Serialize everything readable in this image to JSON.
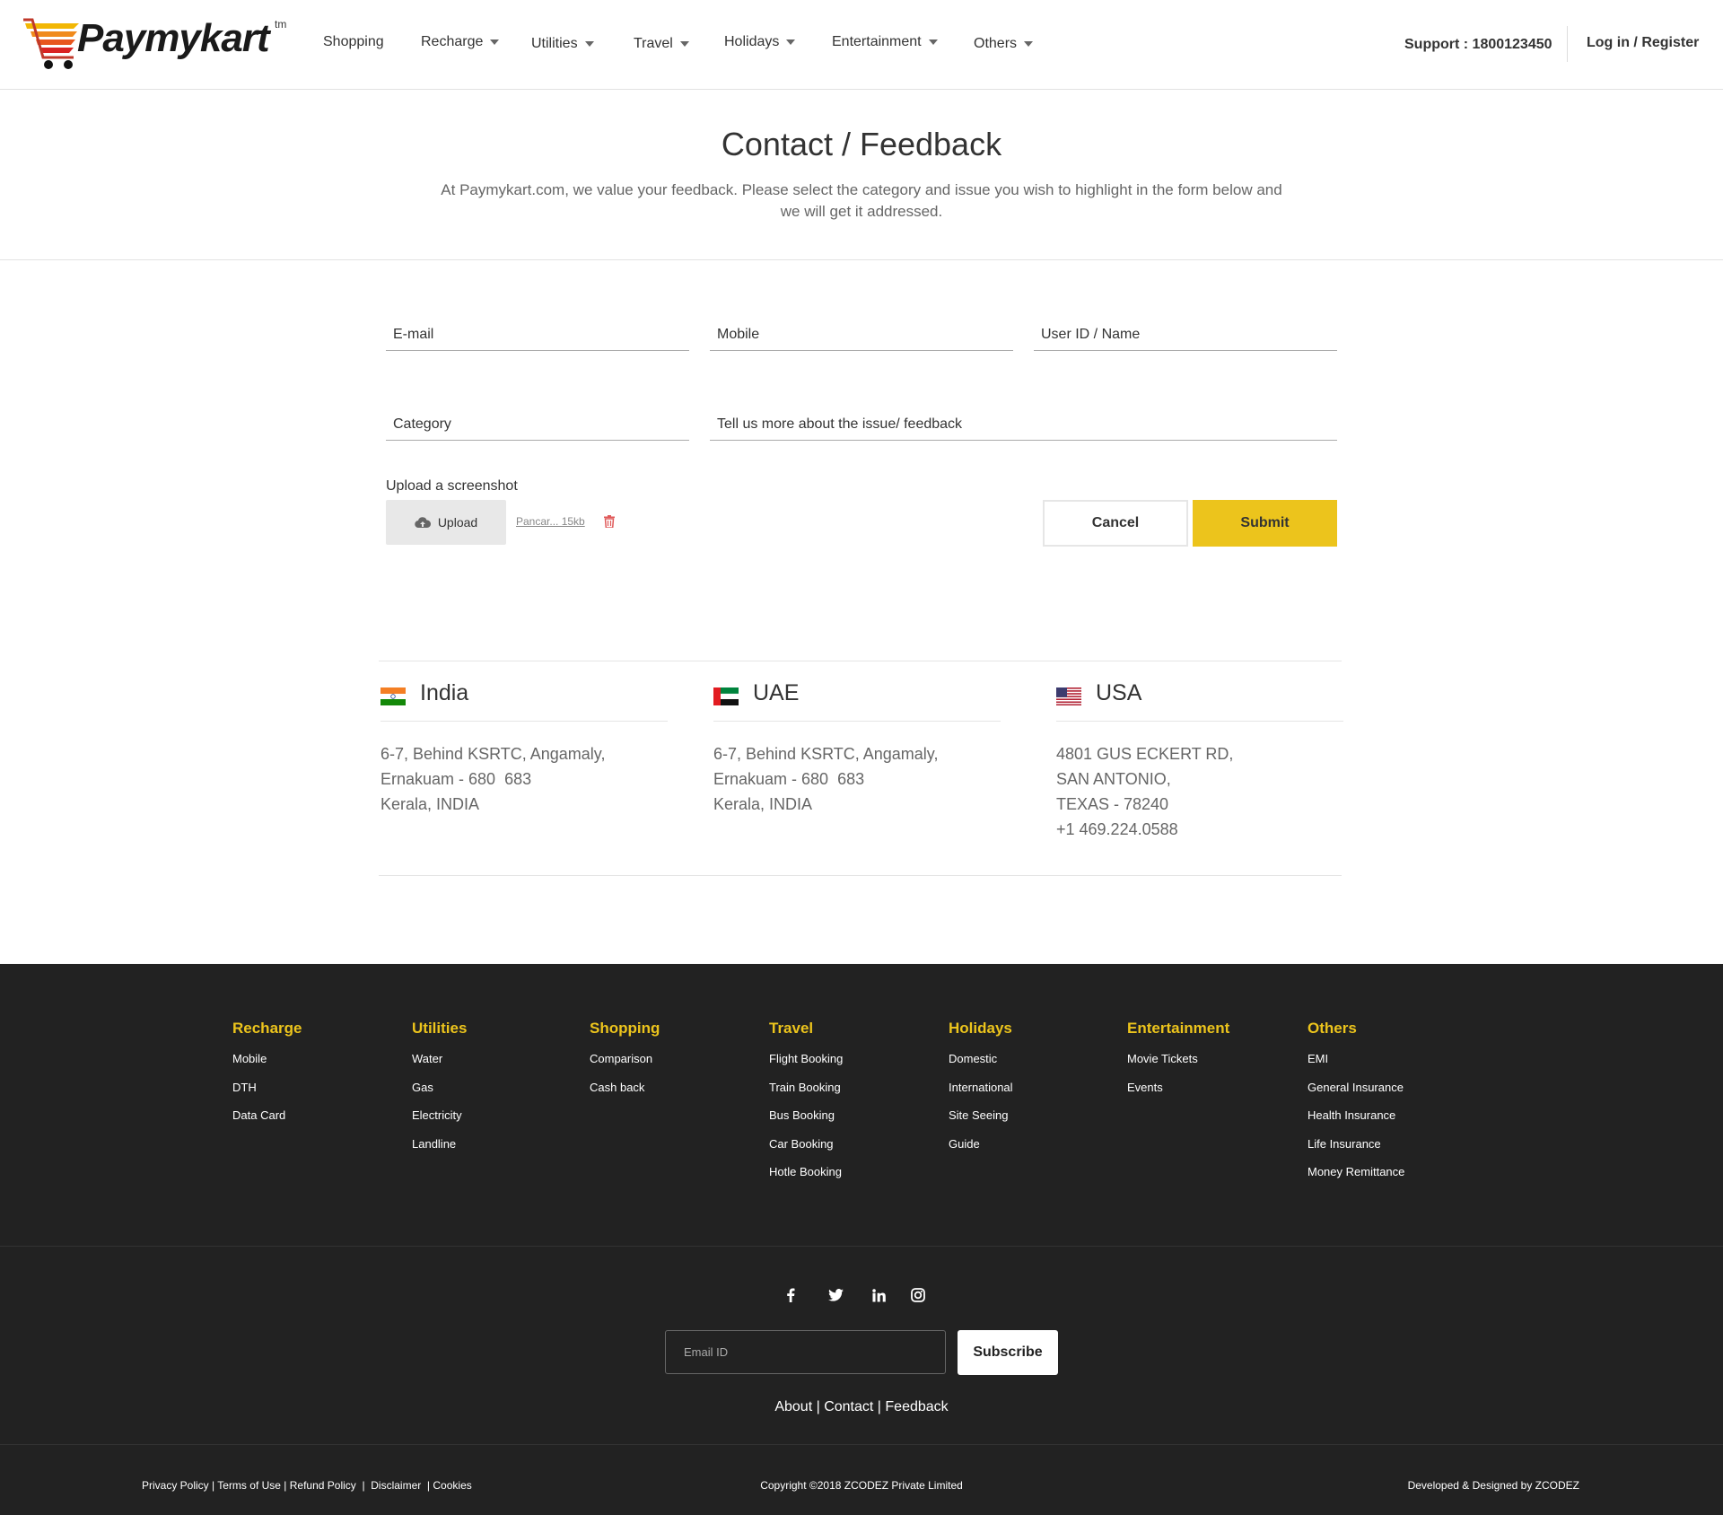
{
  "header": {
    "logo_text": "Paymykart",
    "logo_tm": "tm",
    "nav": [
      {
        "label": "Shopping"
      },
      {
        "label": "Recharge"
      },
      {
        "label": "Utilities"
      },
      {
        "label": "Travel"
      },
      {
        "label": "Holidays"
      },
      {
        "label": "Entertainment"
      },
      {
        "label": "Others"
      }
    ],
    "support": "Support : 1800123450",
    "login": "Log in / Register"
  },
  "intro": {
    "title": "Contact / Feedback",
    "text": "At Paymykart.com, we value your feedback. Please select the category and issue you wish to highlight in the form below and we will get it addressed."
  },
  "form": {
    "email_placeholder": "E-mail",
    "mobile_placeholder": "Mobile",
    "userid_placeholder": "User ID / Name",
    "category_placeholder": "Category",
    "feedback_placeholder": "Tell us more about the issue/ feedback",
    "upload_label": "Upload a screenshot",
    "upload_button": "Upload",
    "file_name": "Pancar... 15kb",
    "cancel": "Cancel",
    "submit": "Submit"
  },
  "offices": [
    {
      "country": "India",
      "lines": [
        "6-7, Behind KSRTC, Angamaly,",
        "Ernakuam - 680  683",
        "Kerala, INDIA"
      ]
    },
    {
      "country": "UAE",
      "lines": [
        "6-7, Behind KSRTC, Angamaly,",
        "Ernakuam - 680  683",
        "Kerala, INDIA"
      ]
    },
    {
      "country": "USA",
      "lines": [
        "4801 GUS ECKERT RD,",
        "SAN ANTONIO,",
        "TEXAS - 78240",
        "+1 469.224.0588"
      ]
    }
  ],
  "footer": {
    "columns": [
      {
        "title": "Recharge",
        "items": [
          "Mobile",
          "DTH",
          "Data Card"
        ]
      },
      {
        "title": "Utilities",
        "items": [
          "Water",
          "Gas",
          "Electricity",
          "Landline"
        ]
      },
      {
        "title": "Shopping",
        "items": [
          "Comparison",
          "Cash back"
        ]
      },
      {
        "title": "Travel",
        "items": [
          "Flight Booking",
          "Train Booking",
          "Bus Booking",
          "Car Booking",
          "Hotle Booking"
        ]
      },
      {
        "title": "Holidays",
        "items": [
          "Domestic",
          "International",
          "Site Seeing",
          "Guide"
        ]
      },
      {
        "title": "Entertainment",
        "items": [
          "Movie Tickets",
          "Events"
        ]
      },
      {
        "title": "Others",
        "items": [
          "EMI",
          "General Insurance",
          "Health Insurance",
          "Life Insurance",
          "Money Remittance"
        ]
      }
    ],
    "socials": [
      "facebook-icon",
      "twitter-icon",
      "linkedin-icon",
      "instagram-icon"
    ],
    "email_placeholder": "Email ID",
    "subscribe": "Subscribe",
    "links": {
      "about": "About",
      "contact": "Contact",
      "feedback": "Feedback"
    },
    "legal": {
      "privacy": "Privacy Policy",
      "terms": "Terms of Use",
      "refund": "Refund Policy",
      "disclaimer": "Disclaimer",
      "cookies": "Cookies"
    },
    "copyright": "Copyright ©2018 ZCODEZ Private Limited",
    "developed_by": "Developed & Designed by ZCODEZ"
  },
  "colors": {
    "accent": "#ecc41c",
    "footer_bg": "#222222",
    "delete": "#e05a5a"
  }
}
